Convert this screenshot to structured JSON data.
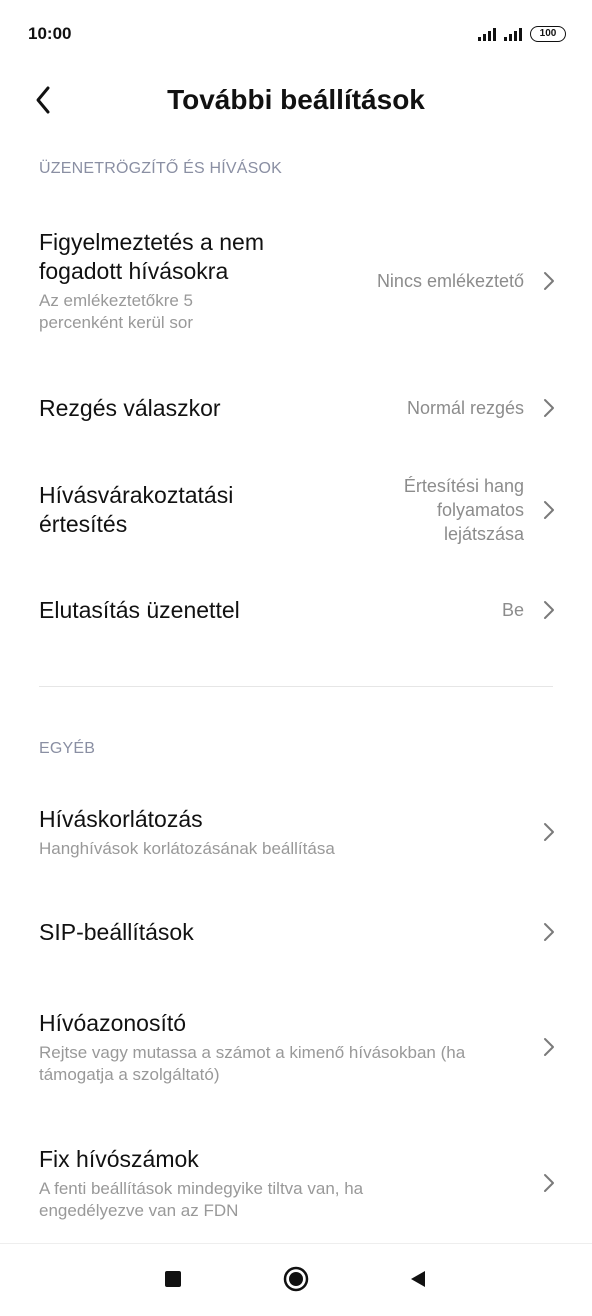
{
  "status_bar": {
    "time": "10:00",
    "battery": "100"
  },
  "header": {
    "title": "További beállítások"
  },
  "sections": [
    {
      "title": "ÜZENETRÖGZÍTŐ ÉS HÍVÁSOK",
      "items": [
        {
          "title": "Figyelmeztetés a nem fogadott hívásokra",
          "subtitle": "Az emlékeztetőkre 5 percenként kerül sor",
          "value": "Nincs emlékeztető"
        },
        {
          "title": "Rezgés válaszkor",
          "value": "Normál rezgés"
        },
        {
          "title": "Hívásvárakoztatási értesítés",
          "value": "Értesítési hang folyamatos lejátszása"
        },
        {
          "title": "Elutasítás üzenettel",
          "value": "Be"
        }
      ]
    },
    {
      "title": "EGYÉB",
      "items": [
        {
          "title": "Híváskorlátozás",
          "subtitle": "Hanghívások korlátozásának beállítása"
        },
        {
          "title": "SIP-beállítások"
        },
        {
          "title": "Hívóazonosító",
          "subtitle": "Rejtse vagy mutassa a számot a kimenő hívásokban (ha támogatja a szolgáltató)"
        },
        {
          "title": "Fix hívószámok",
          "subtitle": "A fenti beállítások mindegyike tiltva van, ha engedélyezve van az FDN"
        }
      ]
    }
  ],
  "icons": {
    "back": "chevron-left-icon",
    "row_chevron": "chevron-right-icon",
    "nav_recents": "square-icon",
    "nav_home": "circle-icon",
    "nav_back": "triangle-left-icon"
  },
  "colors": {
    "section_title": "#8a8fa3",
    "secondary_text": "#8c8c8c"
  }
}
